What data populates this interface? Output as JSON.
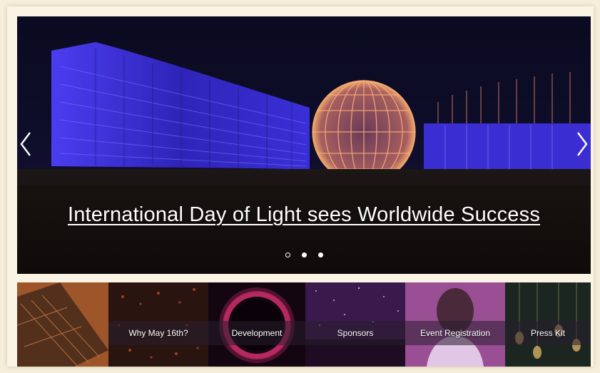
{
  "hero": {
    "headline": "International Day of Light sees Worldwide Success",
    "prev_icon": "chevron-left-icon",
    "next_icon": "chevron-right-icon",
    "slide_count": 3,
    "active_slide": 1
  },
  "nav_tiles": [
    {
      "label": "Why May 16th?"
    },
    {
      "label": "Development"
    },
    {
      "label": "Sponsors"
    },
    {
      "label": "Event Registration"
    },
    {
      "label": "Press Kit"
    }
  ],
  "colors": {
    "page_bg": "#f6eedb",
    "building_blue": "#3b2fd6",
    "sphere_orange": "#f0a86a",
    "sky": "#0b0a1f"
  }
}
